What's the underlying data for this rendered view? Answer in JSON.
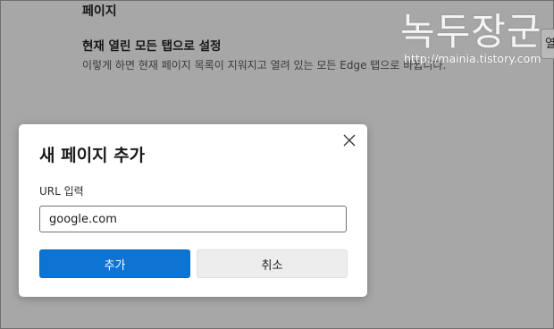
{
  "background": {
    "section_title": "페이지",
    "option_title": "현재 열린 모든 탭으로 설정",
    "option_description": "이렇게 하면 현재 페이지 목록이 지워지고 열려 있는 모든 Edge 탭으로 바뀝니다.",
    "right_button_partial": "열"
  },
  "watermark": {
    "title": "녹두장군",
    "url": "http://mainia.tistory.com"
  },
  "dialog": {
    "title": "새 페이지 추가",
    "close_icon": "close-icon",
    "url_label": "URL 입력",
    "url_value": "google.com",
    "add_label": "추가",
    "cancel_label": "취소"
  },
  "colors": {
    "overlay": "#a7a7a7",
    "primary": "#0d74d3",
    "secondary_button": "#ededed"
  }
}
